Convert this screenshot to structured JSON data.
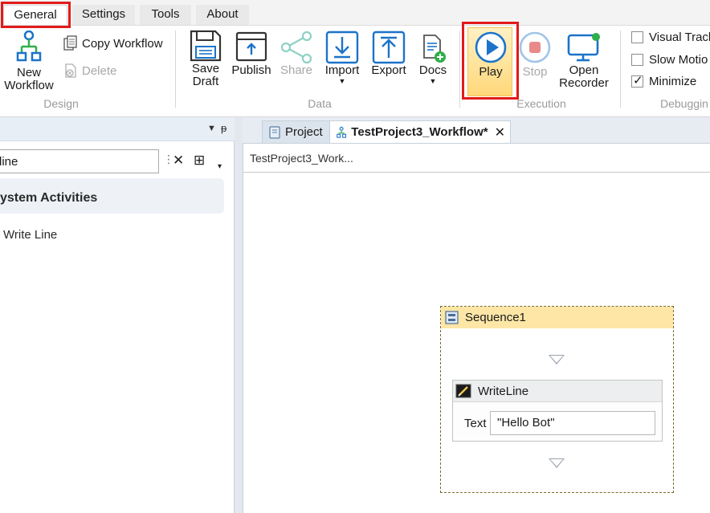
{
  "menu": {
    "tabs": [
      "General",
      "Settings",
      "Tools",
      "About"
    ]
  },
  "ribbon": {
    "design": {
      "new_workflow": "New\nWorkflow",
      "copy_workflow": "Copy Workflow",
      "delete": "Delete",
      "group_label": "Design"
    },
    "data": {
      "save_draft_line1": "Save",
      "save_draft_line2": "Draft",
      "publish": "Publish",
      "share": "Share",
      "import": "Import",
      "export": "Export",
      "docs": "Docs",
      "group_label": "Data"
    },
    "execution": {
      "play": "Play",
      "stop": "Stop",
      "open_recorder_line1": "Open",
      "open_recorder_line2": "Recorder",
      "group_label": "Execution"
    },
    "debugging": {
      "visual_tracking": "Visual Track",
      "slow_motion": "Slow Motio",
      "minimize": "Minimize",
      "group_label": "Debuggin"
    }
  },
  "activities_panel": {
    "search_value": "line",
    "category": "ystem Activities",
    "items": [
      "Write Line"
    ]
  },
  "documents": {
    "tabs": [
      {
        "label": "Project"
      },
      {
        "label": "TestProject3_Workflow*"
      }
    ],
    "breadcrumb": "TestProject3_Work..."
  },
  "designer": {
    "sequence_title": "Sequence1",
    "activity_title": "WriteLine",
    "text_label": "Text",
    "text_value": "\"Hello Bot\""
  },
  "colors": {
    "highlight_red": "#e21a1a",
    "play_blue": "#1c73c9",
    "sequence_header": "#fde6a6",
    "stop_red": "#e88a8a"
  }
}
